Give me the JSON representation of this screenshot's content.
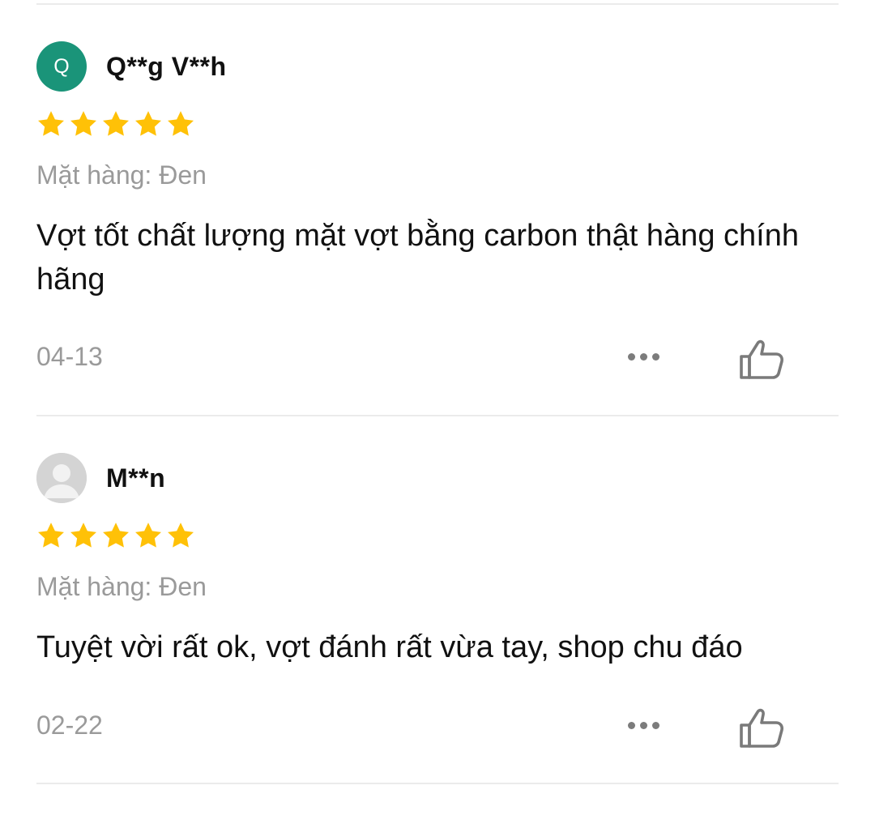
{
  "colors": {
    "star": "#ffc107",
    "avatar_q": "#1a9479",
    "muted_text": "#9a9a9a"
  },
  "reviews": [
    {
      "avatar_letter": "Q",
      "username": "Q**g V**h",
      "rating": 5,
      "variation": "Mặt hàng: Đen",
      "comment": "Vợt tốt chất lượng mặt vợt bằng carbon thật hàng chính hãng",
      "date": "04-13",
      "more_icon": "more-dots-icon",
      "like_icon": "thumbs-up-icon"
    },
    {
      "avatar_letter": "",
      "username": "M**n",
      "rating": 5,
      "variation": "Mặt hàng: Đen",
      "comment": "Tuyệt vời rất ok, vợt đánh rất vừa tay, shop chu đáo",
      "date": "02-22",
      "more_icon": "more-dots-icon",
      "like_icon": "thumbs-up-icon"
    }
  ]
}
